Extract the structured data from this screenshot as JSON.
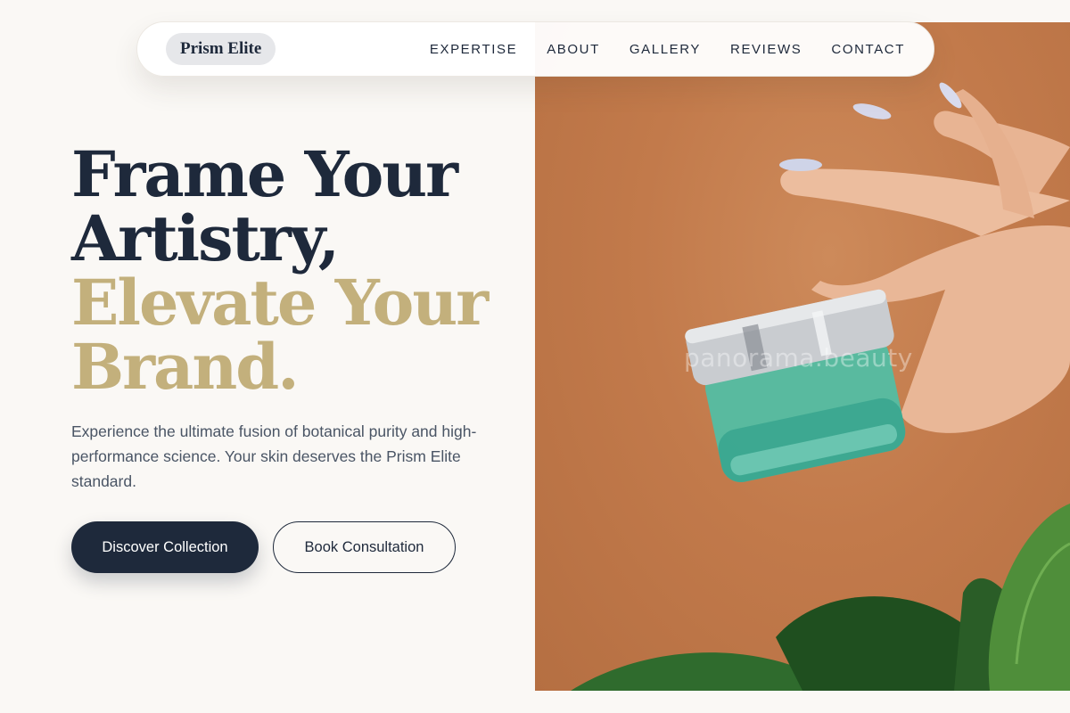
{
  "brand": {
    "name": "Prism Elite"
  },
  "nav": {
    "items": [
      {
        "label": "EXPERTISE"
      },
      {
        "label": "ABOUT"
      },
      {
        "label": "GALLERY"
      },
      {
        "label": "REVIEWS"
      },
      {
        "label": "CONTACT"
      }
    ]
  },
  "hero": {
    "headline_dark_1": "Frame Your",
    "headline_dark_2": "Artistry,",
    "headline_gold_1": "Elevate Your",
    "headline_gold_2": "Brand.",
    "description": "Experience the ultimate fusion of botanical purity and high-performance science. Your skin deserves the Prism Elite standard.",
    "primary_cta": "Discover Collection",
    "secondary_cta": "Book Consultation",
    "image_watermark": "panorama.beauty"
  },
  "colors": {
    "navy": "#1e293b",
    "gold": "#c3b07c",
    "background": "#faf8f5",
    "image_backdrop": "#c27a4b"
  }
}
